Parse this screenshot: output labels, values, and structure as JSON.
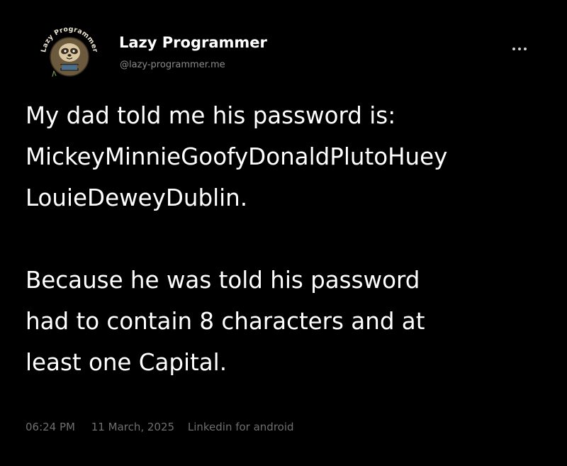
{
  "author": {
    "display_name": "Lazy Programmer",
    "handle": "@lazy-programmer.me",
    "avatar": {
      "icon": "sloth-avatar-icon",
      "ring_text": "Lazy Programmer"
    }
  },
  "menu": {
    "icon": "more-options-icon"
  },
  "tweet": {
    "lines": [
      "My dad told me his password is:",
      "MickeyMinnieGoofyDonaldPlutoHuey",
      "LouieDeweyDublin.",
      "Because he was told his password",
      "had to contain 8 characters and at",
      "least one Capital."
    ]
  },
  "meta": {
    "time": "06:24 PM",
    "date": "11 March, 2025",
    "source": "Linkedin for android"
  },
  "colors": {
    "background": "#000000",
    "text": "#ffffff",
    "muted": "#8a8a8a",
    "meta": "#6f6f6f"
  }
}
